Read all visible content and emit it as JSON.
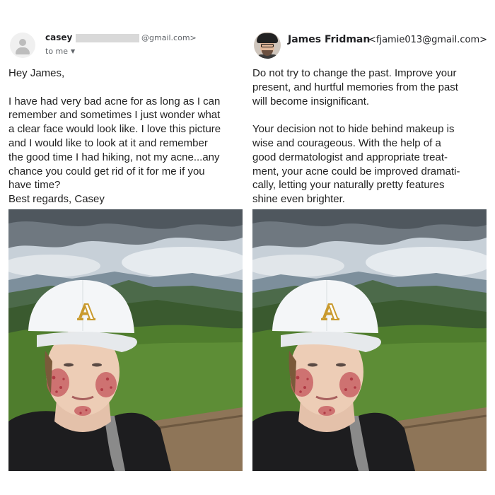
{
  "left_email": {
    "sender_name": "casey",
    "sender_address_suffix": "@gmail.com>",
    "to_label": "to me",
    "greeting": "Hey James,",
    "body_lines": [
      "I have had very bad acne for as long as I can",
      "remember and sometimes I just wonder what",
      "a clear face would look like. I love this picture",
      "and I would like to look at it and remember",
      "the good time I had hiking, not my acne...any",
      "chance you could get rid of it for me if you",
      "have time?",
      "Best regards, Casey"
    ],
    "cap_letter": "A"
  },
  "right_email": {
    "sender_name": "James Fridman",
    "sender_address": "<fjamie013@gmail.com>",
    "paragraph1_lines": [
      "Do not try to change the past. Improve your",
      "present, and hurtful memories from the past",
      "will become insignificant."
    ],
    "paragraph2_lines": [
      "Your decision not to hide behind makeup is",
      "wise and courageous. With the help of a",
      "good dermatologist and appropriate treat-",
      "ment, your acne could be improved dramati-",
      "cally, letting your naturally pretty features",
      "shine even brighter."
    ],
    "cap_letter": "A"
  },
  "colors": {
    "acne": "#c4545a",
    "cap": "#f4f6f8",
    "sky": "#c9d2d9",
    "forest": "#4c7a2e"
  },
  "icons": [
    "person-avatar-icon",
    "chevron-down-icon"
  ]
}
